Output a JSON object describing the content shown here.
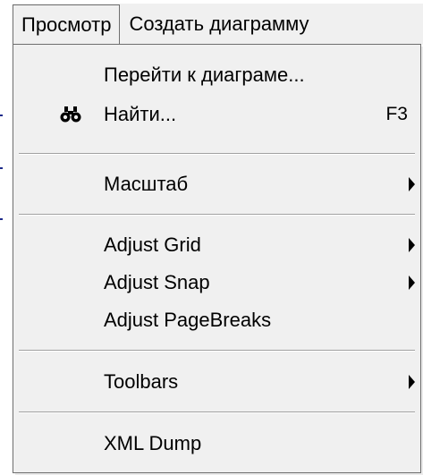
{
  "menubar": {
    "items": [
      {
        "label": "Просмотр"
      },
      {
        "label": "Создать диаграмму"
      }
    ]
  },
  "menu": {
    "items": [
      {
        "label": "Перейти к диаграме...",
        "shortcut": "",
        "submenu": false,
        "icon": ""
      },
      {
        "label": "Найти...",
        "shortcut": "F3",
        "submenu": false,
        "icon": "binoculars-icon"
      },
      {
        "label": "Масштаб",
        "shortcut": "",
        "submenu": true,
        "icon": ""
      },
      {
        "label": "Adjust Grid",
        "shortcut": "",
        "submenu": true,
        "icon": ""
      },
      {
        "label": "Adjust Snap",
        "shortcut": "",
        "submenu": true,
        "icon": ""
      },
      {
        "label": "Adjust PageBreaks",
        "shortcut": "",
        "submenu": false,
        "icon": ""
      },
      {
        "label": "Toolbars",
        "shortcut": "",
        "submenu": true,
        "icon": ""
      },
      {
        "label": "XML Dump",
        "shortcut": "",
        "submenu": false,
        "icon": ""
      }
    ]
  },
  "colors": {
    "menu_background": "#f0f0f0",
    "border": "#6e6e6e",
    "separator": "#a0a0a0",
    "text": "#000000"
  }
}
